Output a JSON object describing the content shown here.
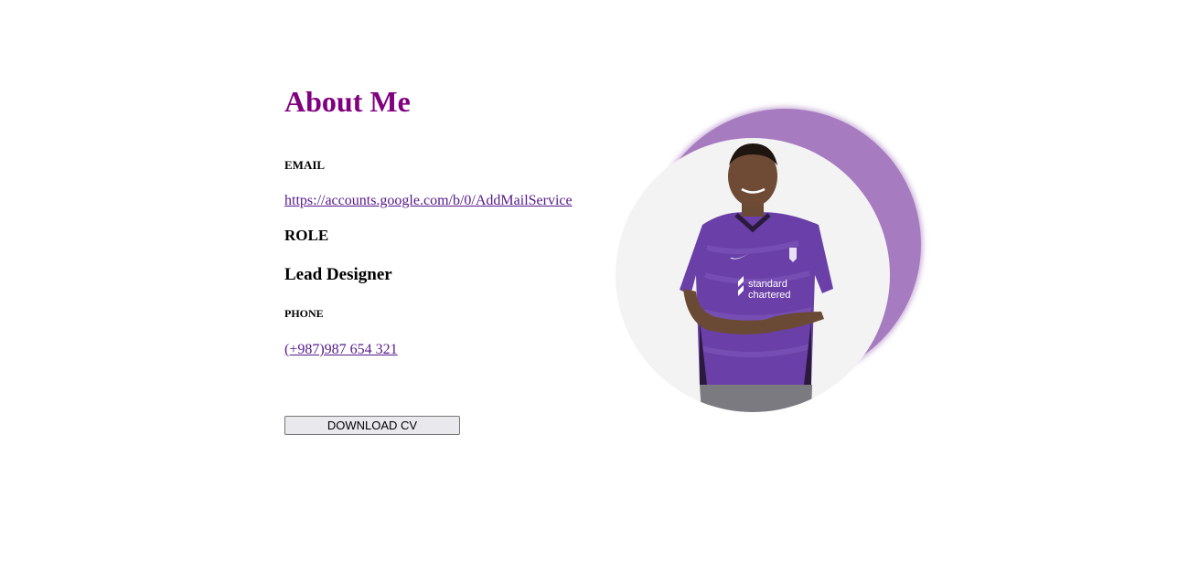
{
  "about": {
    "title": "About Me",
    "email_label": "EMAIL",
    "email_link": "https://accounts.google.com/b/0/AddMailService",
    "role_label": "ROLE",
    "role_value": "Lead Designer",
    "phone_label": "PHONE",
    "phone_link": "(+987)987 654 321",
    "download_label": "DOWNLOAD CV"
  },
  "photo": {
    "icon": "profile-photo",
    "shirt_text_line1": "standard",
    "shirt_text_line2": "chartered"
  },
  "colors": {
    "title": "#800080",
    "link": "#551a8b",
    "accent_circle": "#a77bc0",
    "photo_bg": "#f3f3f3",
    "jersey": "#6a3fa8"
  }
}
